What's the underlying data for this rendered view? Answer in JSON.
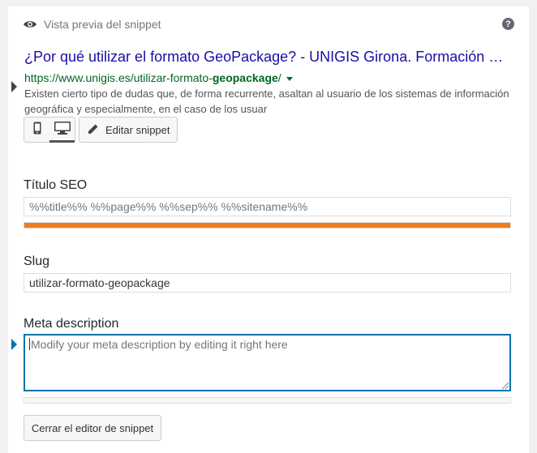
{
  "header": {
    "title": "Vista previa del snippet",
    "eye_icon": "eye-icon",
    "help_icon": "help-icon",
    "help_glyph": "?"
  },
  "serp": {
    "title": "¿Por qué utilizar el formato GeoPackage? - UNIGIS Girona. Formación …",
    "url_prefix": "https://www.unigis.es/utilizar-formato-",
    "url_bold": "geopackage",
    "url_suffix": "/",
    "description": "Existen cierto tipo de dudas que, de forma recurrente, asaltan al usuario de los sistemas de información geográfica y especialmente, en el caso de los usuar"
  },
  "toolbar": {
    "mobile_icon": "mobile-icon",
    "desktop_icon": "desktop-icon",
    "active_device": "desktop",
    "edit_label": "Editar snippet",
    "edit_icon": "pencil-icon"
  },
  "seo_title": {
    "label": "Título SEO",
    "value": "%%title%% %%page%% %%sep%% %%sitename%%",
    "progress": 1.0,
    "progress_color": "#ee7c1b"
  },
  "slug": {
    "label": "Slug",
    "value": "utilizar-formato-geopackage"
  },
  "meta": {
    "label": "Meta description",
    "placeholder": "Modify your meta description by editing it right here",
    "progress": 0.0
  },
  "close_button": {
    "label": "Cerrar el editor de snippet"
  },
  "colors": {
    "link": "#1a0dab",
    "url": "#006621",
    "focus": "#0073aa",
    "marker_dark": "#444444",
    "marker_blue": "#0073aa"
  }
}
